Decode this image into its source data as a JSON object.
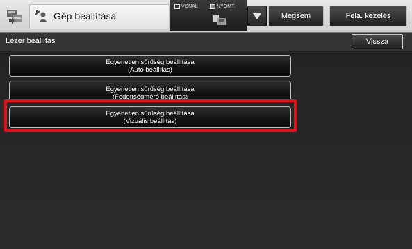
{
  "header": {
    "app_icon": "machine-settings-icon",
    "title_icon": "user-settings-icon",
    "title": "Gép beállítása",
    "indicators": {
      "vonal_label": "VONAL",
      "nyomt_label": "NYOMT.",
      "printer_icon": "printer-icon"
    },
    "dropdown_icon": "triangle-down-icon",
    "cancel_label": "Mégsem",
    "release_label": "Fela. kezelés"
  },
  "subheader": {
    "title": "Lézer beállítás",
    "back_label": "Vissza"
  },
  "options": [
    {
      "line1": "Egyenetlen sűrűség beállítása",
      "line2": "(Auto beállítás)"
    },
    {
      "line1": "Egyenetlen sűrűség beállítása",
      "line2": "(Fedettségmérő beállítás)"
    },
    {
      "line1": "Egyenetlen sűrűség beállítása",
      "line2": "(Vizuális beállítás)"
    }
  ],
  "highlight": {
    "selected_index": 2,
    "color": "#e0111a"
  },
  "colors": {
    "accent_red": "#e0111a",
    "panel_dark": "#242424",
    "topbar_light": "#d9d9d9"
  }
}
